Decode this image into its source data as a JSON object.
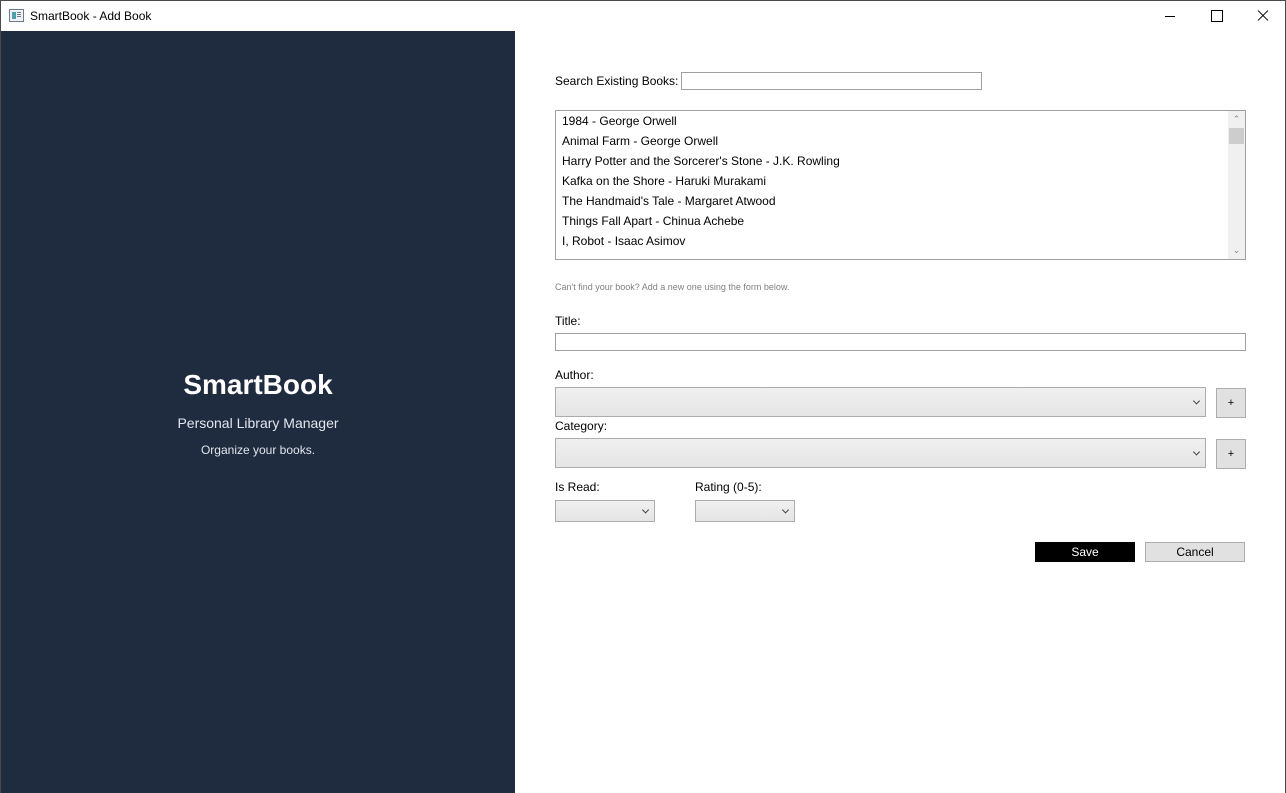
{
  "window": {
    "title": "SmartBook - Add Book"
  },
  "brand": {
    "title": "SmartBook",
    "subtitle": "Personal Library Manager",
    "tagline": "Organize your books.",
    "background": "#1f2b3e"
  },
  "search": {
    "label": "Search Existing Books:",
    "value": ""
  },
  "books": [
    "1984 - George Orwell",
    "Animal Farm - George Orwell",
    "Harry Potter and the Sorcerer's Stone - J.K. Rowling",
    "Kafka on the Shore - Haruki Murakami",
    "The Handmaid's Tale - Margaret Atwood",
    "Things Fall Apart - Chinua Achebe",
    "I, Robot - Isaac Asimov"
  ],
  "hint": "Can't find your book? Add a new one using the form below.",
  "form": {
    "title_label": "Title:",
    "title_value": "",
    "author_label": "Author:",
    "author_value": "",
    "author_add": "+",
    "category_label": "Category:",
    "category_value": "",
    "category_add": "+",
    "isread_label": "Is Read:",
    "isread_value": "",
    "rating_label": "Rating (0-5):",
    "rating_value": ""
  },
  "actions": {
    "save": "Save",
    "cancel": "Cancel"
  }
}
